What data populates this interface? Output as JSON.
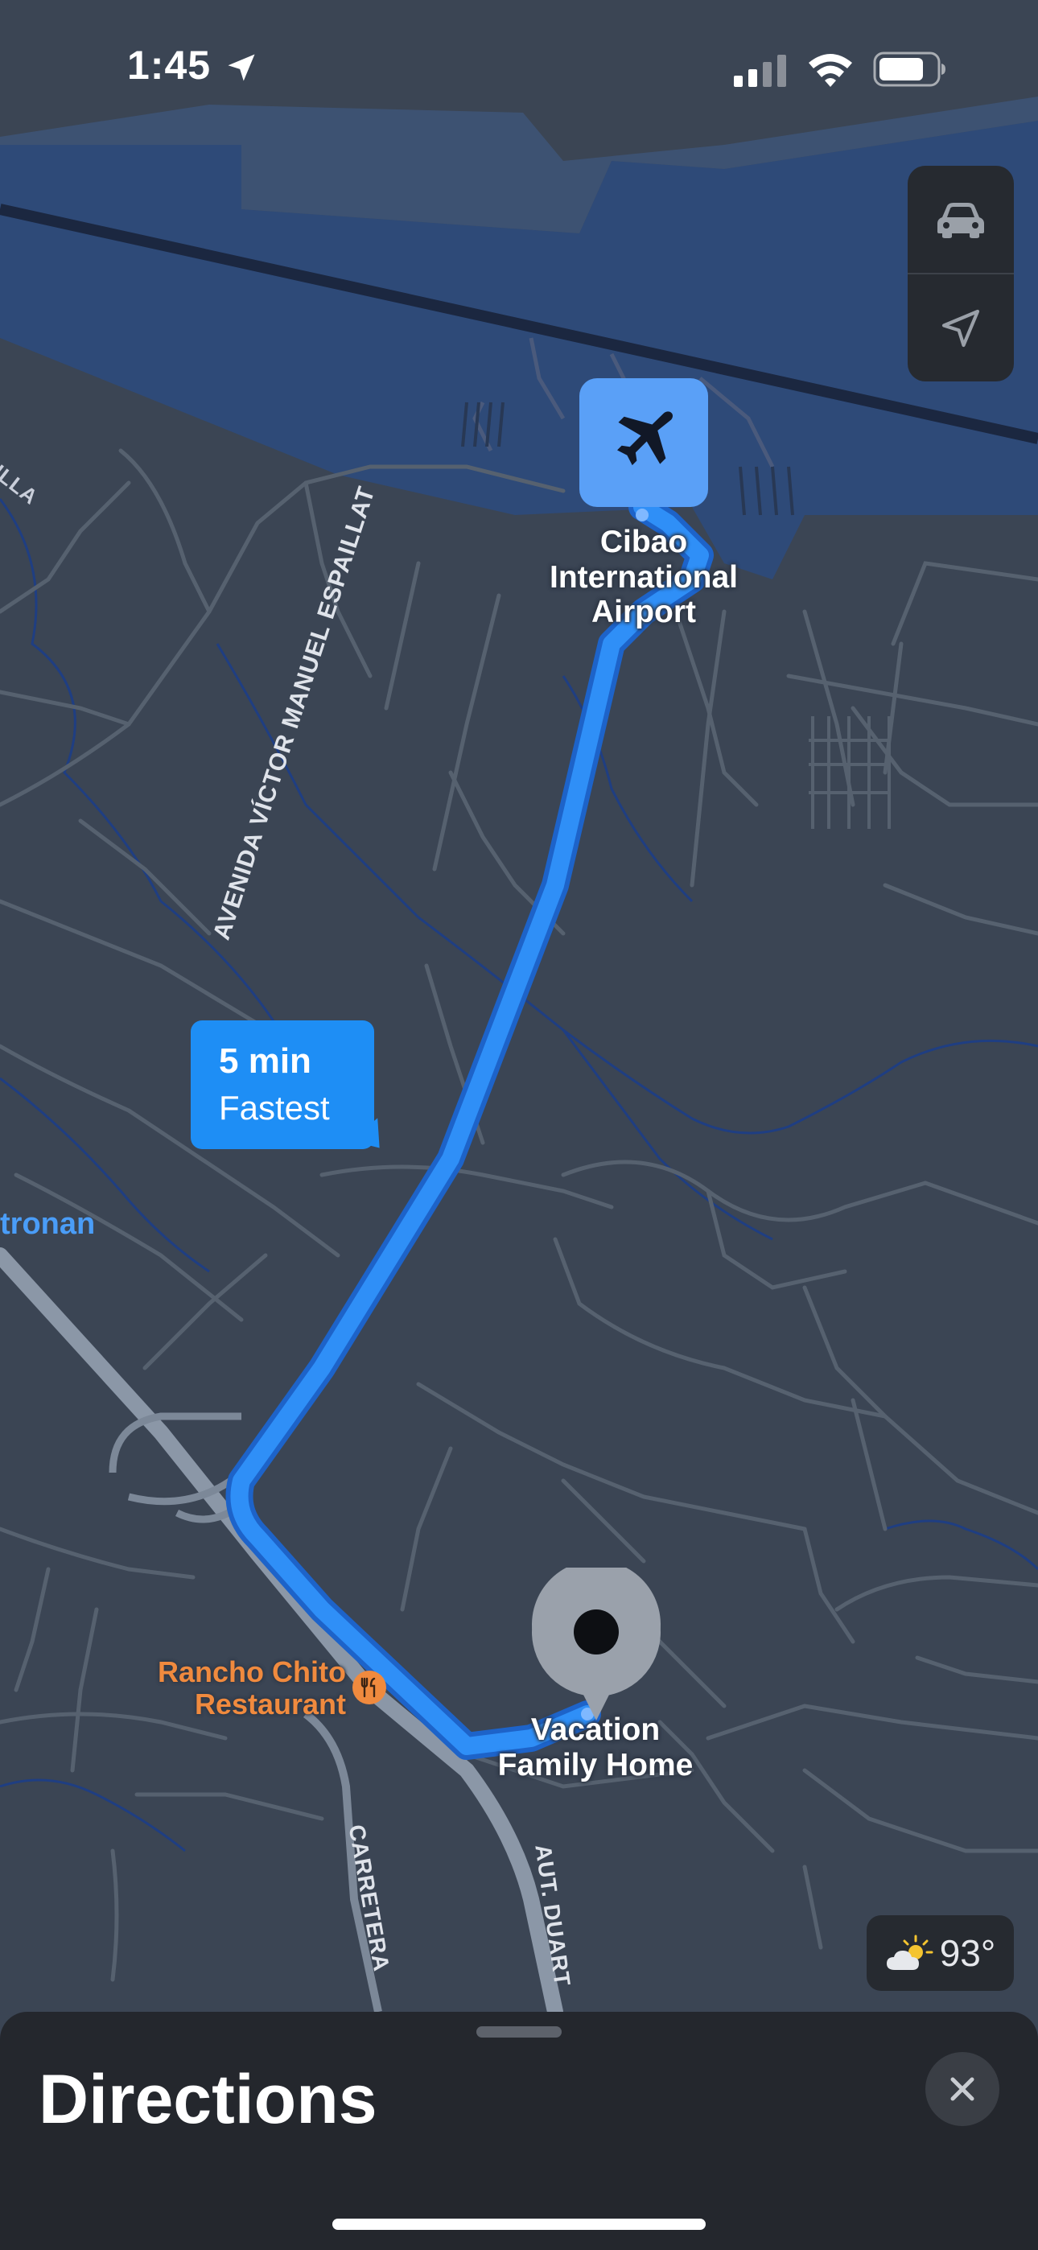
{
  "status_bar": {
    "time": "1:45",
    "icons": [
      "location-arrow-icon",
      "cellular-signal-icon",
      "wifi-icon",
      "battery-icon"
    ]
  },
  "map_controls": {
    "buttons": [
      {
        "name": "driving-mode-button",
        "icon": "car-icon"
      },
      {
        "name": "track-location-button",
        "icon": "location-arrow-icon"
      }
    ]
  },
  "map": {
    "pois": {
      "airport_name": "Cibao\nInternational\nAirport",
      "home_name": "Vacation\nFamily Home",
      "restaurant_name": "Rancho Chito\nRestaurant",
      "place_partial": "tronan"
    },
    "roads": {
      "main_avenue": "AVENIDA VÍCTOR MANUEL ESPAILLAT",
      "highway": "AUT. DUART",
      "carretera": "CARRETERA",
      "villa": "VILLA"
    },
    "route": {
      "duration": "5 min",
      "label": "Fastest",
      "color": "#2f8ff7"
    },
    "colors": {
      "land": "#3b4554",
      "water_airport": "#2e4a78",
      "roads": "#56616f",
      "highway": "#8b97a7",
      "streams": "#1d3a7a"
    }
  },
  "weather": {
    "icon": "partly-sunny-icon",
    "temperature": "93°"
  },
  "sheet": {
    "title": "Directions",
    "close_icon": "close-icon"
  }
}
